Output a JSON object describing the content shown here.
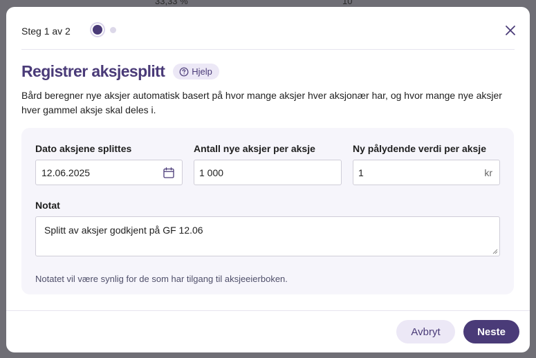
{
  "backdrop": {
    "left_value": "33,33 %",
    "right_value": "10"
  },
  "header": {
    "step_label": "Steg 1 av 2",
    "total_steps": 2,
    "current_step": 1
  },
  "title": "Registrer aksjesplitt",
  "help_label": "Hjelp",
  "description": "Bård beregner nye aksjer automatisk basert på hvor mange aksjer hver aksjonær har, og hvor mange nye aksjer hver gammel aksje skal deles i.",
  "form": {
    "date": {
      "label": "Dato aksjene splittes",
      "value": "12.06.2025",
      "icon": "calendar-icon"
    },
    "new_shares": {
      "label": "Antall nye aksjer per aksje",
      "value": "1 000"
    },
    "par_value": {
      "label": "Ny pålydende verdi per aksje",
      "value": "1",
      "suffix": "kr"
    },
    "note": {
      "label": "Notat",
      "value": "Splitt av aksjer godkjent på GF 12.06",
      "helper": "Notatet vil være synlig for de som har tilgang til aksjeeierboken."
    }
  },
  "footer": {
    "cancel_label": "Avbryt",
    "next_label": "Neste"
  },
  "colors": {
    "accent": "#4a3b78",
    "accent_light": "#ece8f6",
    "panel": "#f6f5fb"
  }
}
